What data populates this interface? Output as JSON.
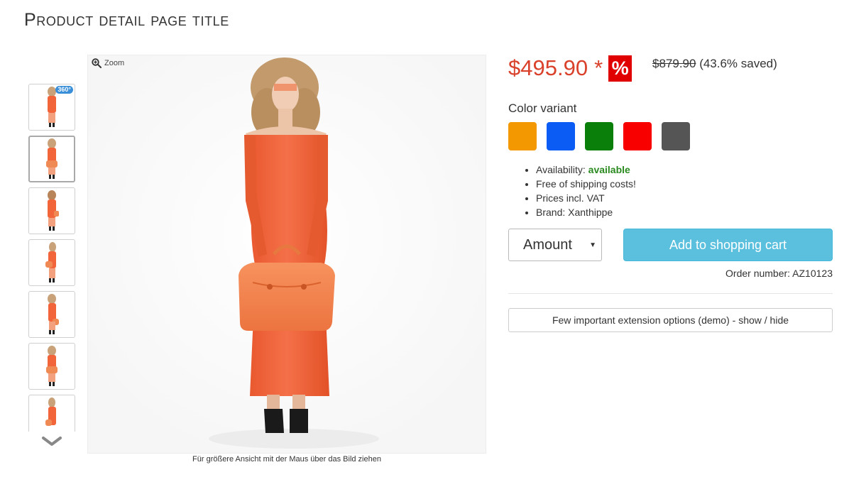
{
  "page": {
    "title": "Product detail page title"
  },
  "gallery": {
    "zoom_label": "Zoom",
    "hint": "Für größere Ansicht mit der Maus über das Bild ziehen",
    "badge_360": "360°",
    "thumbnails_count": 7,
    "active_thumbnail": 2
  },
  "price": {
    "current": "$495.90",
    "asterisk": "*",
    "sale_badge": "%",
    "old": "$879.90",
    "saved": "(43.6% saved)"
  },
  "color_variant": {
    "label": "Color variant",
    "swatches": [
      "#f39800",
      "#0a5cf5",
      "#0a800a",
      "#f80000",
      "#555555"
    ]
  },
  "info": {
    "availability_label": "Availability:",
    "availability_value": "available",
    "shipping": "Free of shipping costs!",
    "vat": "Prices incl. VAT",
    "brand": "Brand: Xanthippe"
  },
  "cart": {
    "amount_label": "Amount",
    "add_button": "Add to shopping cart",
    "order_number": "Order number: AZ10123"
  },
  "extensions": {
    "toggle_label": "Few important extension options (demo) - show / hide"
  },
  "colors": {
    "price": "#d9412b",
    "sale_badge": "#e10000",
    "cart_button": "#5bc0de",
    "available": "#2a8a1f",
    "dress": "#f2653a"
  }
}
